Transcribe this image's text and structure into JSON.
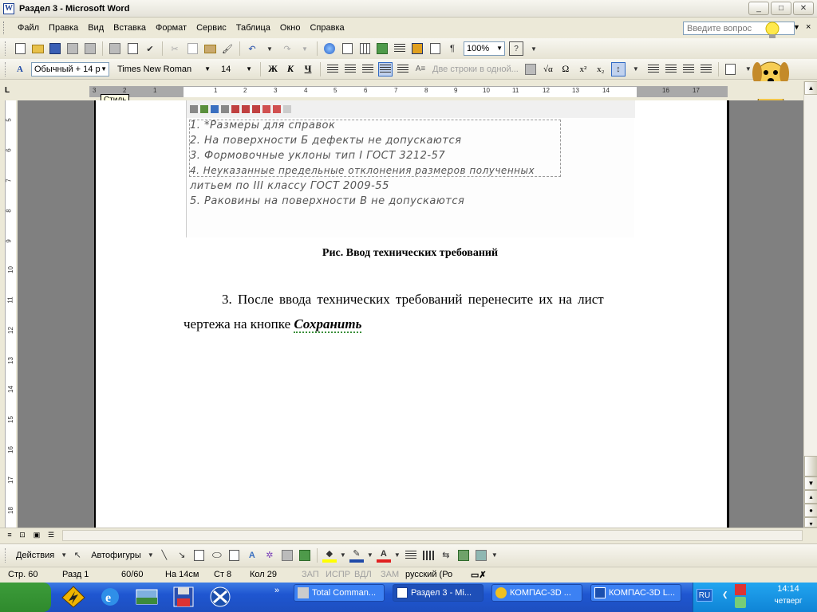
{
  "window": {
    "title": "Раздел 3 - Microsoft Word",
    "app_icon": "W",
    "controls": [
      "_",
      "□",
      "✕"
    ]
  },
  "menu": {
    "items": [
      "Файл",
      "Правка",
      "Вид",
      "Вставка",
      "Формат",
      "Сервис",
      "Таблица",
      "Окно",
      "Справка"
    ],
    "help_placeholder": "Введите вопрос",
    "close_glyph": "×"
  },
  "toolbar_standard": {
    "zoom": "100%",
    "icons": [
      "new-icon",
      "open-icon",
      "save-icon",
      "permission-icon",
      "email-icon",
      "print-icon",
      "print-preview-icon",
      "spelling-icon",
      "cut-icon",
      "copy-icon",
      "paste-icon",
      "format-painter-icon",
      "undo-icon",
      "redo-icon",
      "hyperlink-icon",
      "tables-borders-icon",
      "insert-table-icon",
      "insert-excel-icon",
      "columns-icon",
      "drawing-icon",
      "document-map-icon",
      "show-hide-icon",
      "help-icon"
    ]
  },
  "toolbar_formatting": {
    "style": "Обычный + 14 р",
    "font": "Times New Roman",
    "size": "14",
    "bold": "Ж",
    "italic": "К",
    "underline": "Ч",
    "two_lines": "Две строки в одной...",
    "symbols": [
      "√α",
      "Ω",
      "x²",
      "x₂"
    ]
  },
  "ruler": {
    "corner": "L",
    "tooltip": "Стиль",
    "h_numbers": [
      "3",
      "2",
      "1",
      "1",
      "2",
      "3",
      "4",
      "5",
      "6",
      "7",
      "8",
      "9",
      "10",
      "11",
      "12",
      "13",
      "14",
      "16",
      "17"
    ],
    "v_numbers": [
      "5",
      "6",
      "7",
      "8",
      "9",
      "10",
      "11",
      "12",
      "13",
      "14",
      "15",
      "16",
      "17",
      "18"
    ]
  },
  "document": {
    "embedded_lines": [
      "1. *Размеры для справок",
      "2. На поверхности Б дефекты не допускаются",
      "3. Формовочные уклоны тип I ГОСТ 3212-57",
      "4. Неуказанные  предельные  отклонения  размеров  полученных",
      "литьем по III классу ГОСТ 2009-55",
      "5. Раковины на поверхности В не допускаются"
    ],
    "caption": "Рис. Ввод технических требований",
    "para1": "3. После ввода технических требований перенесите их на лист",
    "para2_prefix": "чертежа на кнопке ",
    "para2_emphasis": "Сохранить"
  },
  "drawing_toolbar": {
    "actions": "Действия",
    "autoshapes": "Автофигуры"
  },
  "status": {
    "page": "Стр.  60",
    "section": "Разд  1",
    "pages": "60/60",
    "at": "На  14см",
    "line": "Ст  8",
    "col": "Кол  29",
    "rec": "ЗАП",
    "trk": "ИСПР",
    "ext": "ВДЛ",
    "ovr": "ЗАМ",
    "lang": "русский (Ро"
  },
  "taskbar": {
    "chevron": "»",
    "tasks": [
      {
        "label": "Total Comman...",
        "active": false
      },
      {
        "label": "Раздел 3 - Mi...",
        "active": true
      },
      {
        "label": "КОМПАС-3D ...",
        "active": false
      },
      {
        "label": "КОМПАС-3D L...",
        "active": false
      }
    ],
    "lang": "RU",
    "time": "14:14",
    "day": "четверг"
  },
  "colors": {
    "taskbar": "#245edb",
    "start": "#3c9c3a",
    "tray": "#0f84d6",
    "doc_bg": "#808080"
  }
}
